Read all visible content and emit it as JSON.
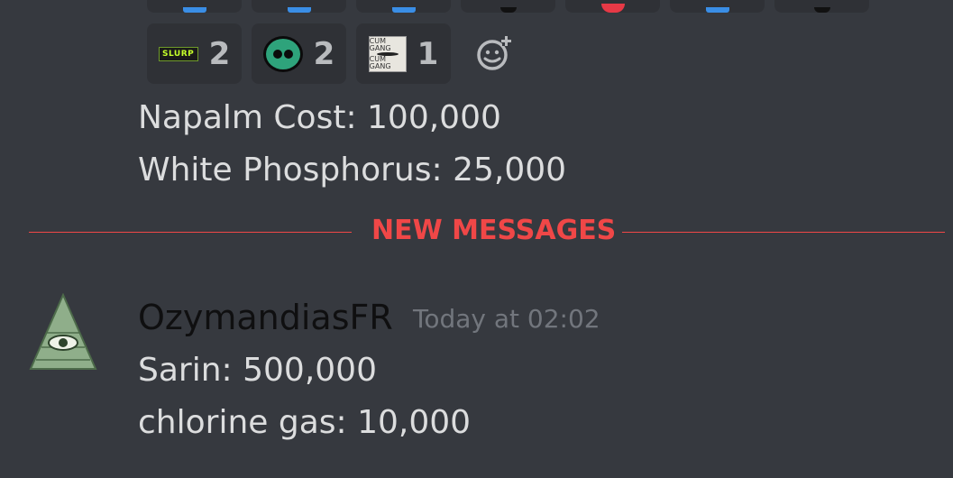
{
  "reactions": {
    "bottom_row": [
      {
        "icon": "slurp-emoji-icon",
        "count": "2"
      },
      {
        "icon": "green-blob-emoji-icon",
        "count": "2"
      },
      {
        "icon": "gang-emoji-icon",
        "count": "1"
      }
    ]
  },
  "prev_message": {
    "lines": [
      "Napalm Cost: 100,000",
      "White Phosphorus: 25,000"
    ]
  },
  "divider": {
    "label": "NEW MESSAGES"
  },
  "message": {
    "username": "OzymandiasFR",
    "timestamp": "Today at 02:02",
    "lines": [
      "Sarin: 500,000",
      "chlorine gas: 10,000"
    ]
  },
  "emoji_images": {
    "slurp_text": "SLURP",
    "gang_top": "CUM GANG",
    "gang_bottom": "CUM GANG"
  },
  "colors": {
    "background": "#36393f",
    "new_messages": "#f04747",
    "username": "#0f0f10",
    "timestamp": "#72767d"
  }
}
